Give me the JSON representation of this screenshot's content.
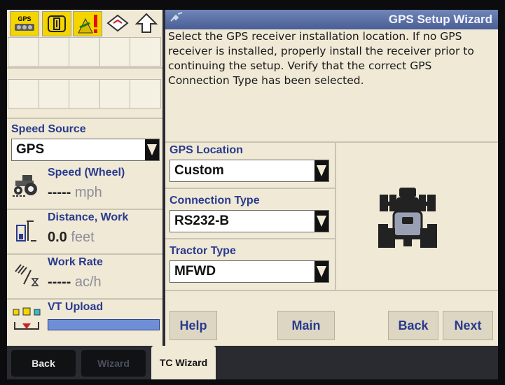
{
  "window": {
    "title": "GPS Setup Wizard",
    "instructions": "Select the GPS receiver installation location. If no GPS receiver is installed, properly install the receiver prior to continuing the setup. Verify that the correct GPS Connection Type has been selected."
  },
  "status_icons": {
    "gps_label": "GPS",
    "icons": [
      "gps-receiver-icon",
      "implement-icon",
      "warning-alert-icon",
      "field-map-icon",
      "up-arrow-icon"
    ]
  },
  "left_panel": {
    "speed_source": {
      "label": "Speed Source",
      "value": "GPS"
    },
    "speed": {
      "label": "Speed (Wheel)",
      "value": "-----",
      "unit": "mph"
    },
    "distance": {
      "label": "Distance, Work",
      "value": "0.0",
      "unit": "feet"
    },
    "work_rate": {
      "label": "Work Rate",
      "value": "-----",
      "unit": "ac/h"
    },
    "vt_upload": {
      "label": "VT Upload"
    }
  },
  "form": {
    "gps_location": {
      "label": "GPS Location",
      "value": "Custom"
    },
    "connection_type": {
      "label": "Connection Type",
      "value": "RS232-B"
    },
    "tractor_type": {
      "label": "Tractor Type",
      "value": "MFWD"
    }
  },
  "buttons": {
    "help": "Help",
    "main": "Main",
    "back": "Back",
    "next": "Next"
  },
  "tabs": {
    "back": "Back",
    "wizard": "Wizard",
    "tc_wizard": "TC Wizard"
  },
  "colors": {
    "panel_bg": "#efe9d6",
    "label_blue": "#2a3a8e",
    "title_bar": "#5a6fa5",
    "active_tab": "#efe9d6"
  }
}
